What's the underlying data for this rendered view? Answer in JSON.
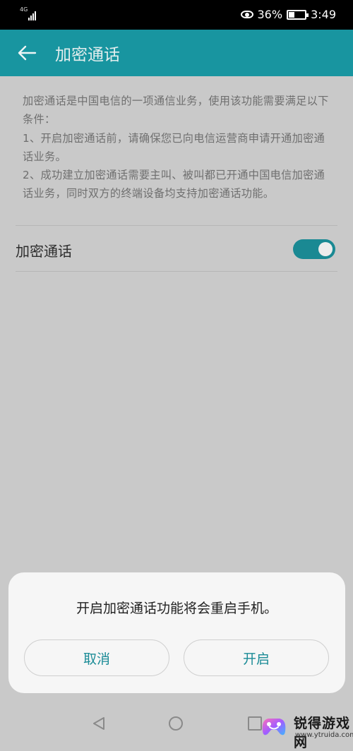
{
  "status_bar": {
    "network_type": "4G",
    "battery_percent": "36%",
    "battery_level": 0.36,
    "time": "3:49"
  },
  "app_bar": {
    "title": "加密通话",
    "back_icon": "arrow-left-icon"
  },
  "description": "加密通话是中国电信的一项通信业务，使用该功能需要满足以下条件：\n1、开启加密通话前，请确保您已向电信运营商申请开通加密通话业务。\n2、成功建立加密通话需要主叫、被叫都已开通中国电信加密通话业务，同时双方的终端设备均支持加密通话功能。",
  "setting": {
    "label": "加密通话",
    "enabled": true
  },
  "dialog": {
    "message": "开启加密通话功能将会重启手机。",
    "cancel_label": "取消",
    "confirm_label": "开启"
  },
  "watermark": {
    "name": "锐得游戏网",
    "url": "www.ytruida.com"
  },
  "colors": {
    "accent": "#1895a0",
    "toggle_on": "#1a8993",
    "button_text": "#1a8b96"
  }
}
